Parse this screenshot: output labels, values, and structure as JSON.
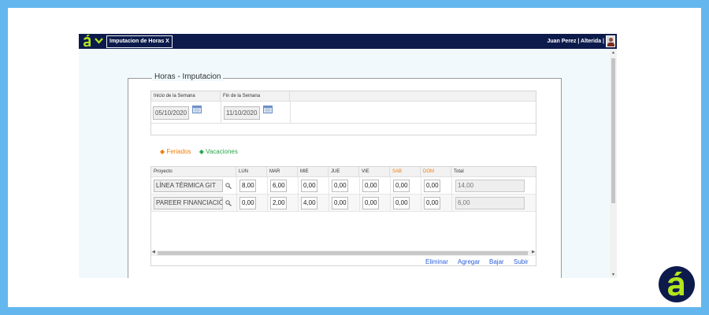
{
  "topbar": {
    "tab_label": "Imputacion de Horas X",
    "user_text": "Juan Perez | Alterida |"
  },
  "form": {
    "legend": "Horas - Imputacion",
    "week": {
      "start_label": "Inicio de la Semana",
      "end_label": "Fin de la Semana",
      "start_value": "05/10/2020",
      "end_value": "11/10/2020"
    },
    "legend_items": {
      "feriados": "◆ Feriados",
      "vacaciones": "◆ Vacaciones"
    },
    "grid": {
      "headers": [
        "Proyecto",
        "LUN",
        "MAR",
        "MIE",
        "JUE",
        "VIE",
        "SAB",
        "DOM",
        "Total"
      ],
      "rows": [
        {
          "proyecto": "LÍNEA TÉRMICA GIT",
          "lun": "8,00",
          "mar": "6,00",
          "mie": "0,00",
          "jue": "0,00",
          "vie": "0,00",
          "sab": "0,00",
          "dom": "0,00",
          "total": "14,00"
        },
        {
          "proyecto": "PAREER FINANCIACIÓN",
          "lun": "0,00",
          "mar": "2,00",
          "mie": "4,00",
          "jue": "0,00",
          "vie": "0,00",
          "sab": "0,00",
          "dom": "0,00",
          "total": "6,00"
        }
      ]
    },
    "actions": {
      "eliminar": "Eliminar",
      "agregar": "Agregar",
      "bajar": "Bajar",
      "subir": "Subir"
    }
  },
  "colors": {
    "topbar": "#0c1b4b",
    "accent_green": "#b5e51d",
    "weekend": "#f07d0b",
    "feriados": "#f07d0b",
    "vacaciones": "#2aa84a",
    "link": "#2b5fd9",
    "page_background": "#63b7ee"
  },
  "icons": {
    "logo": "brand-a-logo",
    "menu": "chevron-down-icon",
    "calendar": "calendar-icon",
    "search": "magnifier-icon"
  }
}
